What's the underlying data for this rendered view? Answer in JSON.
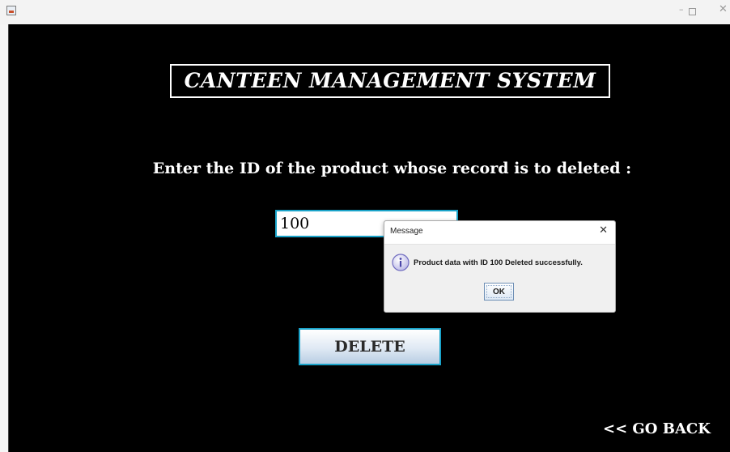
{
  "window": {
    "title": "",
    "controls": {
      "minimize": "–",
      "close": "✕"
    }
  },
  "main": {
    "title": "CANTEEN MANAGEMENT SYSTEM",
    "prompt": "Enter the ID of the product whose record is to deleted :",
    "id_input_value": "100",
    "delete_label": "DELETE",
    "go_back_label": "<< GO BACK"
  },
  "dialog": {
    "title": "Message",
    "close_glyph": "✕",
    "message": "Product data with ID 100 Deleted successfully.",
    "ok_label": "OK",
    "icon": "info-icon"
  },
  "colors": {
    "background": "#000000",
    "accent": "#1aa3c9",
    "title_text": "#ffffff"
  }
}
